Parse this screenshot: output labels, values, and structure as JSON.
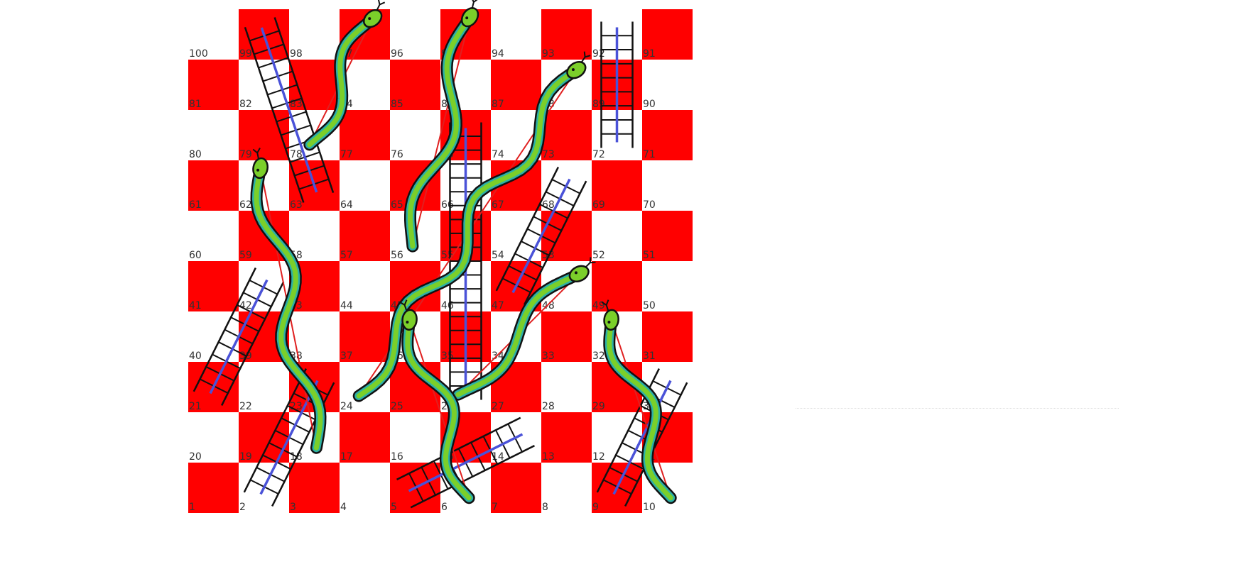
{
  "board": {
    "rows": 10,
    "cols": 10,
    "colors": {
      "red": "#ff0000",
      "white": "#ffffff",
      "number": "#333333"
    },
    "top_row_first_cell_red": false
  },
  "ladders": [
    {
      "from": 63,
      "to": 99
    },
    {
      "from": 72,
      "to": 92
    },
    {
      "from": 21,
      "to": 42
    },
    {
      "from": 2,
      "to": 23
    },
    {
      "from": 5,
      "to": 14
    },
    {
      "from": 9,
      "to": 30
    },
    {
      "from": 26,
      "to": 75
    },
    {
      "from": 47,
      "to": 68
    }
  ],
  "snakes": [
    {
      "head": 97,
      "tail": 78
    },
    {
      "head": 95,
      "tail": 56
    },
    {
      "head": 88,
      "tail": 24
    },
    {
      "head": 62,
      "tail": 18
    },
    {
      "head": 48,
      "tail": 26
    },
    {
      "head": 36,
      "tail": 6
    },
    {
      "head": 32,
      "tail": 10
    }
  ],
  "colors": {
    "snake_body": "#7bcf2a",
    "snake_belly": "#2bb0a8",
    "snake_outline": "#111111",
    "ladder_rail": "#111111",
    "ladder_center": "#4a52d8",
    "red_trail": "#e02020"
  }
}
